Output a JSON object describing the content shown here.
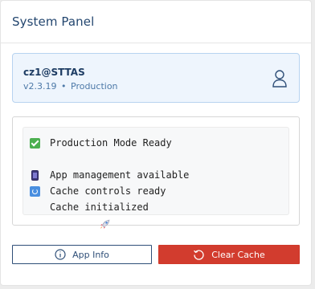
{
  "panel": {
    "title": "System Panel"
  },
  "user": {
    "name": "cz1@STTAS",
    "version": "v2.3.19",
    "separator": "•",
    "environment": "Production",
    "icon": "user-icon"
  },
  "status": {
    "lines": [
      {
        "icon": "check-icon",
        "text": "Production Mode Ready"
      },
      {
        "icon": "phone-icon",
        "text": "App management available"
      },
      {
        "icon": "refresh-icon",
        "text": "Cache controls ready"
      },
      {
        "icon": "rocket-icon",
        "text": "Cache initialized"
      }
    ]
  },
  "buttons": {
    "app_info_label": "App Info",
    "app_info_icon": "info-icon",
    "clear_cache_label": "Clear Cache",
    "clear_cache_icon": "refresh-icon"
  },
  "colors": {
    "accent_blue": "#2f4f78",
    "danger_red": "#d23c2e",
    "card_bg": "#eef5fd",
    "success_green": "#4caf50"
  }
}
